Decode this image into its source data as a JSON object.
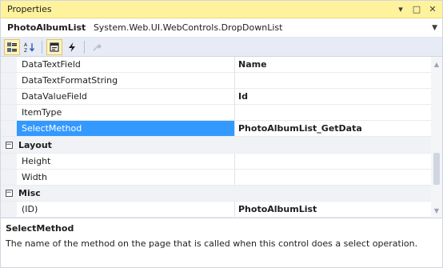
{
  "window": {
    "title": "Properties"
  },
  "object": {
    "name": "PhotoAlbumList",
    "type": "System.Web.UI.WebControls.DropDownList"
  },
  "toolbar": {
    "buttons": [
      {
        "icon": "categorized-icon",
        "active": true
      },
      {
        "icon": "alphabetical-icon",
        "active": false
      },
      {
        "icon": "properties-icon",
        "active": true
      },
      {
        "icon": "events-icon",
        "active": false
      },
      {
        "icon": "property-pages-icon",
        "active": false
      }
    ]
  },
  "grid": {
    "rows": [
      {
        "kind": "prop",
        "name": "DataTextField",
        "value": "Name"
      },
      {
        "kind": "prop",
        "name": "DataTextFormatString",
        "value": ""
      },
      {
        "kind": "prop",
        "name": "DataValueField",
        "value": "Id"
      },
      {
        "kind": "prop",
        "name": "ItemType",
        "value": ""
      },
      {
        "kind": "prop",
        "name": "SelectMethod",
        "value": "PhotoAlbumList_GetData",
        "selected": true
      },
      {
        "kind": "category",
        "name": "Layout",
        "expanded": true
      },
      {
        "kind": "prop",
        "name": "Height",
        "value": ""
      },
      {
        "kind": "prop",
        "name": "Width",
        "value": ""
      },
      {
        "kind": "category",
        "name": "Misc",
        "expanded": true
      },
      {
        "kind": "prop",
        "name": "(ID)",
        "value": "PhotoAlbumList"
      }
    ]
  },
  "description": {
    "title": "SelectMethod",
    "text": "The name of the method on the page that is called when this control does a select operation."
  },
  "colors": {
    "titlebar": "#fff29d",
    "selection": "#3399ff",
    "toolbar": "#e6ebf5"
  }
}
